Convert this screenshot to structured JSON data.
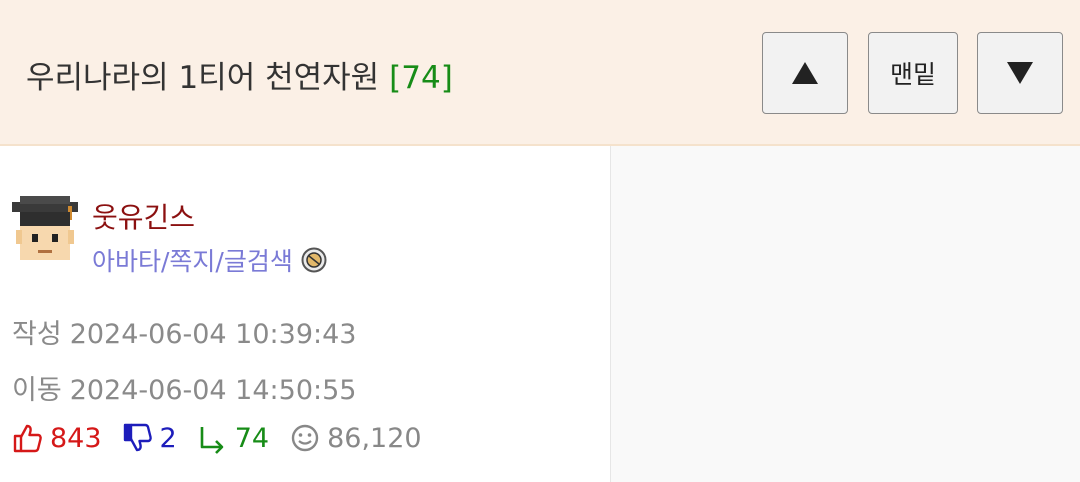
{
  "post": {
    "title": "우리나라의 1티어 천연자원",
    "comment_count": "[74]"
  },
  "nav": {
    "top_label": "맨밑",
    "up_icon": "triangle-up-icon",
    "down_icon": "triangle-down-icon"
  },
  "author": {
    "nickname": "웃유긴스",
    "links": "아바타/쪽지/글검색",
    "avatar_icon": "graduate-avatar-icon",
    "badge_icon": "level-badge-icon"
  },
  "meta": {
    "created_label": "작성",
    "created_time": "2024-06-04 10:39:43",
    "moved_label": "이동",
    "moved_time": "2024-06-04 14:50:55"
  },
  "stats": {
    "upvotes": "843",
    "downvotes": "2",
    "replies": "74",
    "views": "86,120"
  },
  "colors": {
    "header_bg": "#fbf0e6",
    "nickname": "#8b1010",
    "links": "#7a7ad6",
    "upvote": "#d51818",
    "downvote": "#1d1dbb",
    "reply": "#178c17",
    "views": "#888888"
  }
}
